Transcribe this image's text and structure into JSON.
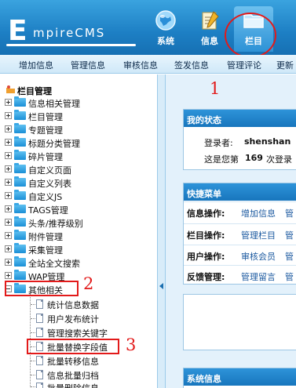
{
  "header": {
    "logo_initial": "E",
    "logo_rest": "mpireCMS",
    "nav": [
      {
        "label": "系统",
        "icon": "globe-icon"
      },
      {
        "label": "信息",
        "icon": "notepad-icon"
      },
      {
        "label": "栏目",
        "icon": "folder-icon",
        "active": true
      }
    ]
  },
  "submenu": [
    "增加信息",
    "管理信息",
    "审核信息",
    "签发信息",
    "管理评论",
    "更新"
  ],
  "tree": {
    "title": "栏目管理",
    "items": [
      "信息相关管理",
      "栏目管理",
      "专题管理",
      "标题分类管理",
      "碎片管理",
      "自定义页面",
      "自定义列表",
      "自定义JS",
      "TAGS管理",
      "头条/推荐级别",
      "附件管理",
      "采集管理",
      "全站全文搜索",
      "WAP管理"
    ],
    "open_item": "其他相关",
    "children": [
      "统计信息数据",
      "用户发布统计",
      "管理搜索关键字",
      "批量替换字段值",
      "批量转移信息",
      "信息批量归档",
      "批量删除信息"
    ]
  },
  "annotations": [
    "1",
    "2",
    "3"
  ],
  "right": {
    "status": {
      "title": "我的状态",
      "login_label": "登录者:",
      "username": "shenshan",
      "visit_prefix": "这是您第",
      "visit_count": "169",
      "visit_suffix": "次登录"
    },
    "quick": {
      "title": "快捷菜单",
      "rows": [
        {
          "key": "信息操作:",
          "val": "增加信息",
          "more": "管"
        },
        {
          "key": "栏目操作:",
          "val": "管理栏目",
          "more": "管"
        },
        {
          "key": "用户操作:",
          "val": "审核会员",
          "more": "管"
        },
        {
          "key": "反馈管理:",
          "val": "管理留言",
          "more": "管"
        }
      ]
    },
    "sysinfo": {
      "title": "系统信息"
    }
  },
  "colors": {
    "header": "#1d7fc4",
    "accent_red": "#e21a1a",
    "link": "#1c5aa0"
  }
}
